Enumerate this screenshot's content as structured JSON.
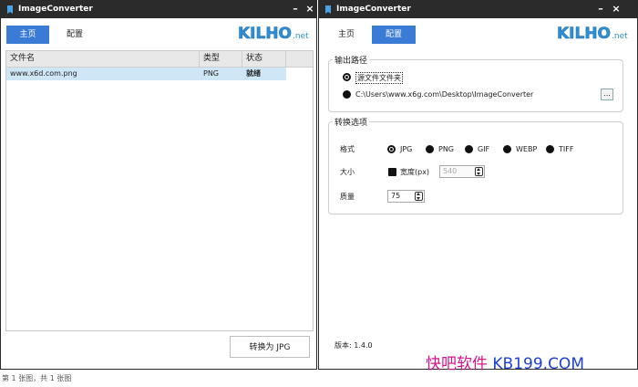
{
  "left_window": {
    "title": "ImageConverter",
    "tabs": [
      {
        "label": "主页",
        "active": true
      },
      {
        "label": "配置",
        "active": false
      }
    ],
    "logo": {
      "main": "KILHO",
      "suffix": ".net"
    },
    "table": {
      "columns": [
        "文件名",
        "类型",
        "状态"
      ],
      "rows": [
        {
          "file": "www.x6d.com.png",
          "type": "PNG",
          "status": "就绪"
        }
      ]
    },
    "convert_button": "转换为 JPG"
  },
  "status_bar": "第 1 张图，共 1 张图",
  "right_window": {
    "title": "ImageConverter",
    "tabs": [
      {
        "label": "主页",
        "active": false
      },
      {
        "label": "配置",
        "active": true
      }
    ],
    "logo": {
      "main": "KILHO",
      "suffix": ".net"
    },
    "output_group": {
      "title": "输出路径",
      "source_folder_label": "源文件文件夹",
      "custom_path": "C:\\Users\\www.x6g.com\\Desktop\\ImageConverter",
      "browse_label": "..."
    },
    "options_group": {
      "title": "转换选项",
      "format_label": "格式",
      "formats": [
        "JPG",
        "PNG",
        "GIF",
        "WEBP",
        "TIFF"
      ],
      "selected_format": "JPG",
      "size_label": "大小",
      "width_label": "宽度(px)",
      "width_value": "540",
      "quality_label": "质量",
      "quality_value": "75"
    },
    "version": "版本: 1.4.0"
  },
  "watermark": {
    "part1": "快吧软件",
    "part2": " KB199.COM"
  },
  "colors": {
    "accent": "#3a7bd5",
    "titlebar": "#2b2b2b",
    "selected_row": "#cfe6f7",
    "logo": "#2e8fd4"
  }
}
